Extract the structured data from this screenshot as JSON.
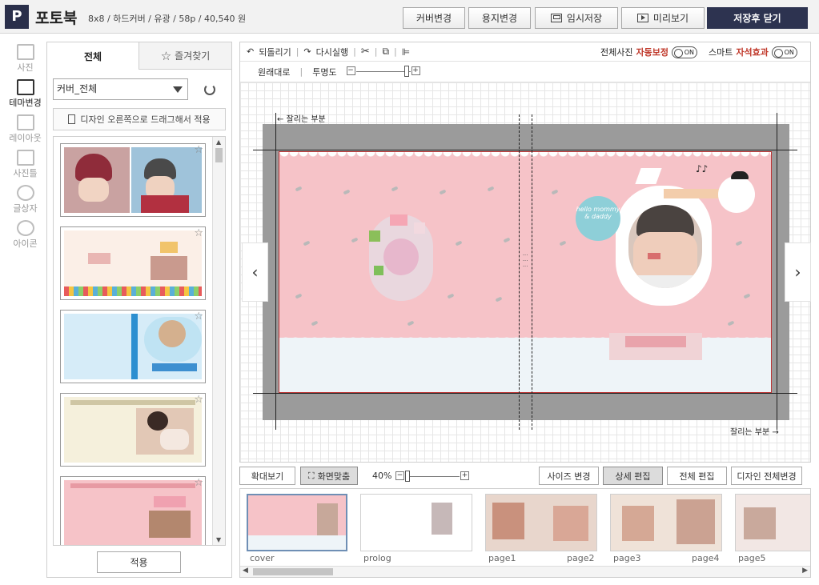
{
  "header": {
    "logo_letter": "P",
    "title": "포토북",
    "subtitle": "8x8 / 하드커버 / 유광 / 58p / 40,540 원",
    "buttons": {
      "cover_change": "커버변경",
      "paper_change": "용지변경",
      "temp_save": "임시저장",
      "preview": "미리보기",
      "save_close": "저장후 닫기"
    }
  },
  "rail": {
    "items": [
      {
        "label": "사진",
        "icon": "photo-icon"
      },
      {
        "label": "테마변경",
        "icon": "theme-icon"
      },
      {
        "label": "레이아웃",
        "icon": "layout-icon"
      },
      {
        "label": "사진틀",
        "icon": "frame-icon"
      },
      {
        "label": "글상자",
        "icon": "text-icon"
      },
      {
        "label": "아이콘",
        "icon": "heart-icon"
      }
    ]
  },
  "panel": {
    "tabs": {
      "all": "전체",
      "favorites": "즐겨찾기"
    },
    "category_select": "커버_전체",
    "hint": "디자인 오른쪽으로 드래그해서 적용",
    "apply": "적용"
  },
  "editor": {
    "toolbar": {
      "undo": "되돌리기",
      "redo": "다시실행",
      "original": "원래대로",
      "opacity": "투명도",
      "auto_correct_prefix": "전체사진",
      "auto_correct": "자동보정",
      "smart_prefix": "스마트",
      "smart_effect": "자석효과",
      "on": "ON"
    },
    "cut_label_top": "← 잘리는 부분",
    "cut_label_bottom": "잘리는 부분 →",
    "bubble_text": "hello mommy & daddy"
  },
  "bottom": {
    "zoom_in": "확대보기",
    "fit_screen": "화면맞춤",
    "zoom_level": "40%",
    "size_change": "사이즈 변경",
    "detail_edit": "상세 편집",
    "full_edit": "전체 편집",
    "design_change": "디자인 전체변경"
  },
  "pages": [
    "cover",
    "prolog",
    "page1",
    "page2",
    "page3",
    "page4",
    "page5"
  ],
  "colors": {
    "accent_dark": "#2d3350",
    "cover_pink": "#f6c3c8",
    "toggle_red": "#c0392b"
  }
}
